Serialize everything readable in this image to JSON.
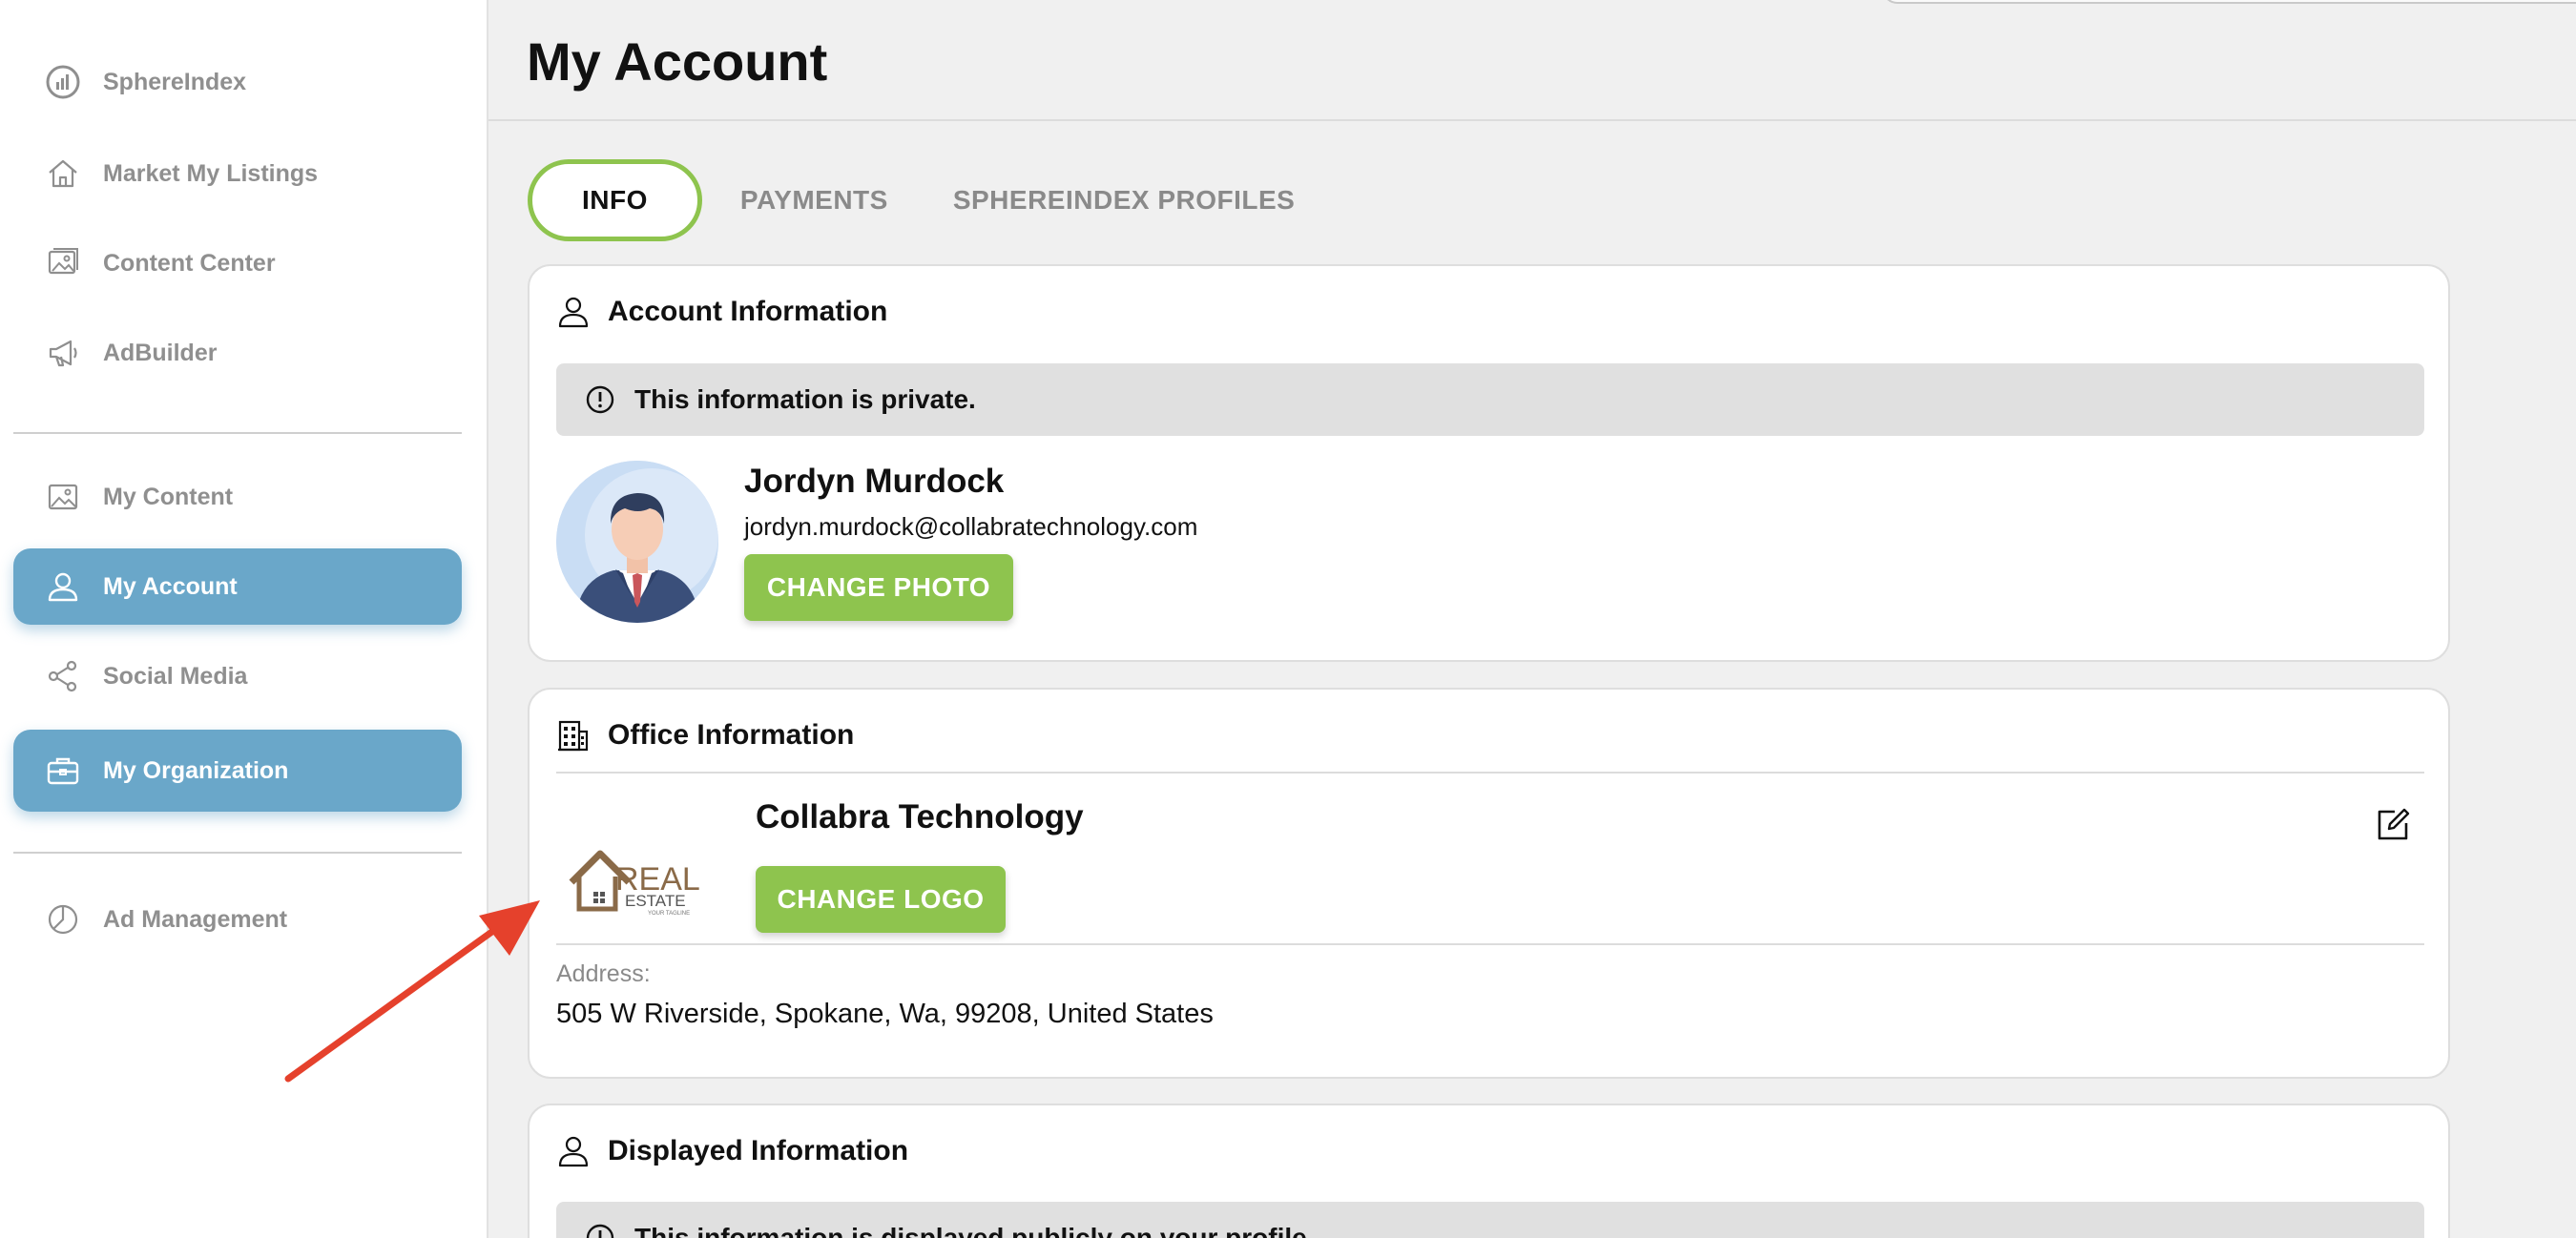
{
  "sidebar": {
    "items": [
      {
        "label": "SphereIndex",
        "icon": "sphereindex-logo-icon"
      },
      {
        "label": "Market My Listings",
        "icon": "home-icon"
      },
      {
        "label": "Content Center",
        "icon": "gallery-icon"
      },
      {
        "label": "AdBuilder",
        "icon": "megaphone-icon"
      },
      {
        "label": "My Content",
        "icon": "image-icon"
      },
      {
        "label": "My Account",
        "icon": "user-icon",
        "active": true
      },
      {
        "label": "Social Media",
        "icon": "share-icon"
      },
      {
        "label": "My Organization",
        "icon": "briefcase-icon",
        "active": true
      },
      {
        "label": "Ad Management",
        "icon": "pie-chart-icon"
      }
    ]
  },
  "page": {
    "title": "My Account"
  },
  "tabs": [
    {
      "label": "INFO",
      "active": true
    },
    {
      "label": "PAYMENTS"
    },
    {
      "label": "SPHEREINDEX PROFILES"
    }
  ],
  "account": {
    "title": "Account Information",
    "notice": "This information is private.",
    "name": "Jordyn Murdock",
    "email": "jordyn.murdock@collabratechnology.com",
    "change_photo_label": "CHANGE PHOTO"
  },
  "office": {
    "title": "Office Information",
    "org_name": "Collabra Technology",
    "change_logo_label": "CHANGE LOGO",
    "logo_text": {
      "main": "REAL",
      "sub": "ESTATE",
      "tagline": "YOUR TAGLINE"
    },
    "address_label": "Address:",
    "address": "505 W Riverside, Spokane, Wa, 99208, United States"
  },
  "displayed": {
    "title": "Displayed Information",
    "notice": "This information is displayed publicly on your profile."
  },
  "colors": {
    "accent_green": "#8ec44e",
    "active_blue": "#6aa7c9",
    "arrow_red": "#e5412c"
  }
}
